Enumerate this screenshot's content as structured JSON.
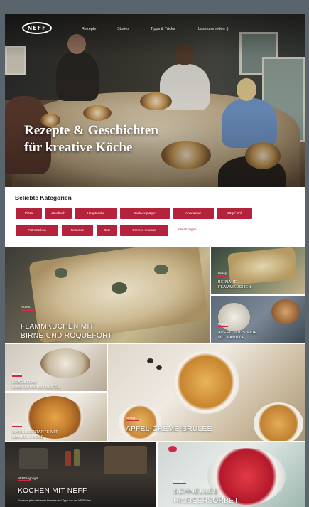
{
  "nav": {
    "logo": "NEFF",
    "links": [
      "Rezepte",
      "Stories",
      "Tipps & Tricks",
      "Lass uns reden :)"
    ]
  },
  "hero": {
    "title_line1": "Rezepte & Geschichten",
    "title_line2": "für kreative Köche"
  },
  "categories": {
    "title": "Beliebte Kategorien",
    "chips_row1": [
      "Pizza",
      "Jakobsch",
      "Hauptsache",
      "Backvergnügen",
      "Ananaskur",
      "BBQ / Grill"
    ],
    "chips_row2": [
      "Frühstücken",
      "Gesunde",
      "Brot",
      "Desserts",
      "Cremes mousse"
    ],
    "all_link": "→ Alle anzeigen"
  },
  "tiles": {
    "flammkuchen": {
      "tag": "Rezept",
      "title_line1": "Flammkuchen mit",
      "title_line2": "Birne und Roquefort"
    },
    "vegan": {
      "tag": "Rezept",
      "title_line1": "Beinahe",
      "title_line2": "Flammkuchen"
    },
    "apfel_sous": {
      "tag": "Rezept",
      "title_line1": "Apfel sous vide",
      "title_line2": "mit Vanille"
    },
    "gebratene": {
      "tag": "Rezept",
      "title_line1": "Gebratene",
      "title_line2": "Rindfleischstreifen"
    },
    "creme": {
      "tag": "Rezept",
      "title": "Apfel-Crème-Brulée"
    },
    "apfeltarte": {
      "tag": "Rezept",
      "title_line1": "Aprikosentarte mit",
      "title_line2": "Mandelcreme"
    },
    "kochen": {
      "tag": "NEFF Highlight",
      "title": "Kochen mit NEFF",
      "subtitle": "Entdecke jetzt die besten Rezepte und Tipps aus der NEFF Welt"
    },
    "sorbet": {
      "tag": "Rezept",
      "title_line1": "Schnelles",
      "title_line2": "Himbeersorbet"
    }
  },
  "colors": {
    "accent": "#b5223c",
    "bar": "#d12a45",
    "frame": "#5a646d"
  }
}
